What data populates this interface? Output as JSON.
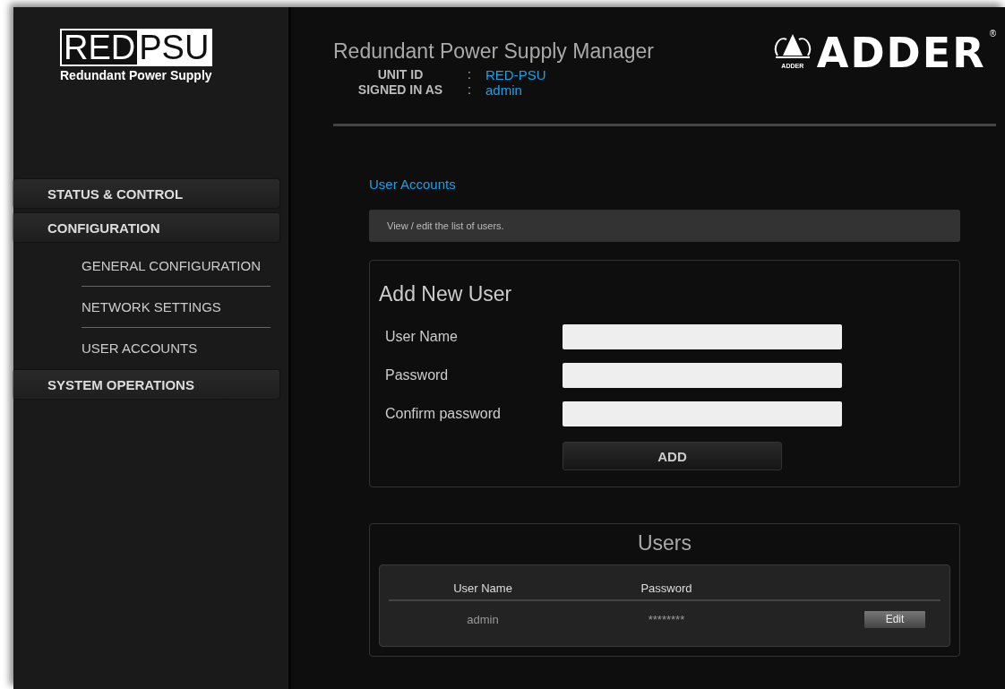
{
  "logo": {
    "left_word": "RED",
    "right_word": "PSU",
    "tagline": "Redundant Power Supply"
  },
  "header": {
    "title": "Redundant Power Supply Manager",
    "info": [
      {
        "label": "UNIT ID",
        "separator": ":",
        "value": "RED-PSU"
      },
      {
        "label": "SIGNED IN AS",
        "separator": ":",
        "value": "admin"
      }
    ],
    "brand": {
      "name": "ADDER",
      "mark": "®",
      "icon_caption": "ADDER"
    }
  },
  "sidebar": {
    "items": [
      {
        "kind": "section",
        "label": "STATUS & CONTROL"
      },
      {
        "kind": "section",
        "label": "CONFIGURATION"
      },
      {
        "kind": "sub",
        "label": "GENERAL CONFIGURATION"
      },
      {
        "kind": "sub",
        "label": "NETWORK SETTINGS"
      },
      {
        "kind": "sub",
        "label": "USER ACCOUNTS"
      },
      {
        "kind": "section",
        "label": "SYSTEM OPERATIONS"
      }
    ]
  },
  "page": {
    "title": "User Accounts",
    "description": "View / edit the list of users."
  },
  "add_user": {
    "title": "Add New User",
    "fields": [
      {
        "label": "User Name"
      },
      {
        "label": "Password"
      },
      {
        "label": "Confirm password"
      }
    ],
    "button": "ADD"
  },
  "users": {
    "title": "Users",
    "columns": [
      "User Name",
      "Password"
    ],
    "rows": [
      {
        "name": "admin",
        "password": "********",
        "action": "Edit"
      }
    ]
  }
}
